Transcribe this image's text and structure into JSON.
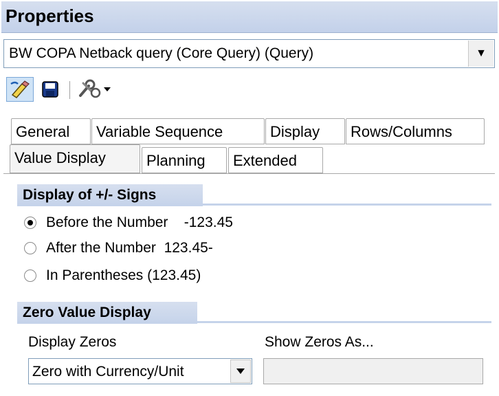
{
  "window": {
    "title": "Properties"
  },
  "query_selector": {
    "value": "BW COPA Netback query (Core Query) (Query)"
  },
  "toolbar": {
    "buttons": [
      {
        "icon": "edit-pencil-icon"
      },
      {
        "icon": "save-disk-icon"
      },
      {
        "icon": "tools-dropdown-icon"
      }
    ]
  },
  "tabs": {
    "row1": [
      "General",
      "Variable Sequence",
      "Display",
      "Rows/Columns"
    ],
    "row2": [
      "Value Display",
      "Planning",
      "Extended"
    ],
    "active": "Value Display"
  },
  "sign_display": {
    "title": "Display of +/- Signs",
    "options": [
      {
        "label": "Before the Number    -123.45",
        "checked": true
      },
      {
        "label": "After the Number  123.45-",
        "checked": false
      },
      {
        "label": "In Parentheses (123.45)",
        "checked": false
      }
    ]
  },
  "zero_display": {
    "title": "Zero Value Display",
    "display_zeros_label": "Display Zeros",
    "display_zeros_value": "Zero with Currency/Unit",
    "show_zeros_as_label": "Show Zeros As...",
    "show_zeros_as_value": ""
  },
  "colors": {
    "header_gradient_top": "#d6dfef",
    "header_gradient_bottom": "#c3d1ea",
    "border": "#7f9db9"
  }
}
